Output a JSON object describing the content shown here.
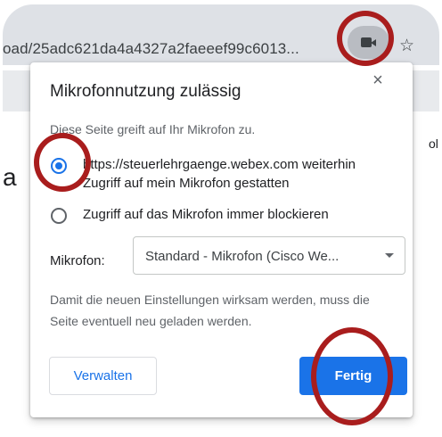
{
  "browser": {
    "url": "oad/25adc621da4a4327a2faeeef99c6013...",
    "camera_icon": "video-camera-icon",
    "star_icon": "bookmark-star-icon",
    "star_glyph": "☆"
  },
  "background_fragments": {
    "left_char": "a",
    "right_text": "ol"
  },
  "bubble": {
    "title": "Mikrofonnutzung zulässig",
    "close_glyph": "×",
    "subtitle": "Diese Seite greift auf Ihr Mikrofon zu.",
    "option_allow": "https://steuerlehrgaenge.webex.com weiterhin Zugriff auf mein Mikrofon gestatten",
    "option_block": "Zugriff auf das Mikrofon immer blockieren",
    "selected_option": "allow",
    "mic_label": "Mikrofon:",
    "mic_select_value": "Standard - Mikrofon (Cisco We...",
    "note": "Damit die neuen Einstellungen wirksam werden, muss die Seite eventuell neu geladen werden.",
    "manage_button": "Verwalten",
    "done_button": "Fertig"
  },
  "colors": {
    "accent": "#1a73e8",
    "highlight_circle": "#a91d1d",
    "chrome_bar": "#dee1e6"
  }
}
